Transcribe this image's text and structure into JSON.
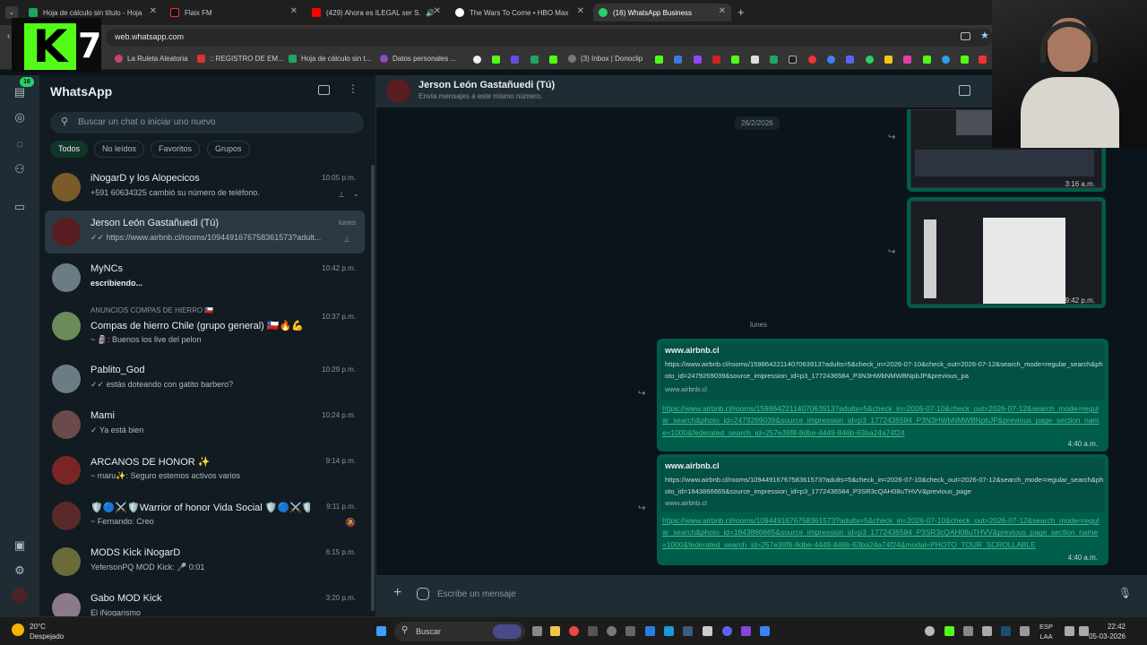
{
  "browser": {
    "tabs": [
      {
        "label": "Hoja de cálculo sin título - Hoja"
      },
      {
        "label": "Flaix FM"
      },
      {
        "label": "(429) Ahora es ILEGAL ser S..."
      },
      {
        "label": "The Wars To Come • HBO Max"
      },
      {
        "label": "(16) WhatsApp Business"
      }
    ],
    "new_tab": "+",
    "url": "web.whatsapp.com",
    "bookmarks": [
      {
        "label": "La Ruleta Aleatoria"
      },
      {
        "label": ":: REGISTRO DE EM..."
      },
      {
        "label": "Hoja de cálculo sin t..."
      },
      {
        "label": "Datos personales ..."
      },
      {
        "label": "(3) Inbox | Donoclip"
      }
    ]
  },
  "overlay": {
    "logo_k": "K",
    "logo_7": "7"
  },
  "rail": {
    "badge": "16"
  },
  "sidebar": {
    "title": "WhatsApp",
    "search_placeholder": "Buscar un chat o iniciar uno nuevo",
    "filters": [
      "Todos",
      "No leídos",
      "Favoritos",
      "Grupos"
    ],
    "chats": [
      {
        "name": "iNogarD y los Alopecicos",
        "sub": "+591 60634325 cambió su número de teléfono.",
        "time": "10:05 p.m.",
        "group": ""
      },
      {
        "name": "Jerson León Gastañuedi (Tú)",
        "sub": "✓✓ https://www.airbnb.cl/rooms/1094491676758361573?adult...",
        "time": "lunes",
        "group": ""
      },
      {
        "name": "MyNCs",
        "sub": "escribiendo...",
        "time": "10:42 p.m.",
        "group": ""
      },
      {
        "name": "Compas de hierro Chile (grupo general) 🇨🇱🔥💪",
        "sub": "~ 🗿: Buenos los live del pelon",
        "time": "10:37 p.m.",
        "group": "ANUNCIOS COMPAS DE HIERRO 🇨🇱"
      },
      {
        "name": "Pablito_God",
        "sub": "✓✓ estás doteando con gatito barbero?",
        "time": "10:29 p.m.",
        "group": ""
      },
      {
        "name": "Mami",
        "sub": "✓ Ya está bien",
        "time": "10:24 p.m.",
        "group": ""
      },
      {
        "name": "ARCANOS DE HONOR ✨",
        "sub": "~ maru✨: Seguro estemos activos varios",
        "time": "9:14 p.m.",
        "group": ""
      },
      {
        "name": "🛡️🔵⚔️🛡️Warrior of honor Vida Social 🛡️🔵⚔️🛡️",
        "sub": "~ Fernando: Creo",
        "time": "9:11 p.m.",
        "group": ""
      },
      {
        "name": "MODS Kick iNogarD",
        "sub": "YefersonPQ MOD Kick: 🎤 0:01",
        "time": "6:15 p.m.",
        "group": ""
      },
      {
        "name": "Gabo MOD Kick",
        "sub": "El iNogarismo",
        "time": "3:20 p.m.",
        "group": ""
      }
    ]
  },
  "chat": {
    "name": "Jerson León Gastañuedi (Tú)",
    "subtitle": "Envía mensajes a este mismo número.",
    "date1": "26/2/2026",
    "date2": "lunes",
    "img_time1": "3:16 a.m.",
    "img_time2": "9:42 p.m.",
    "msg1": {
      "preview_title": "www.airbnb.cl",
      "preview_desc": "https://www.airbnb.cl/rooms/1598642211407063913?adults=5&check_in=2026-07-10&check_out=2026-07-12&search_mode=regular_search&photo_id=2479269039&source_impression_id=p3_1772436584_P3N3HWbNMWBNpbJP&previous_pa",
      "preview_domain": "www.airbnb.cl",
      "link": "https://www.airbnb.cl/rooms/1598642211407063913?adults=5&check_in=2026-07-10&check_out=2026-07-12&search_mode=regular_search&photo_id=2479269039&source_impression_id=p3_1772436584_P3N3HWbNMWBNpbJP&previous_page_section_name=1000&federated_search_id=257e39f8-8dbe-4449-846b-63ba24a74f24",
      "time": "4:40 a.m."
    },
    "msg2": {
      "preview_title": "www.airbnb.cl",
      "preview_desc": "https://www.airbnb.cl/rooms/1094491676758361573?adults=5&check_in=2026-07-10&check_out=2026-07-12&search_mode=regular_search&photo_id=1843866665&source_impression_id=p3_1772436584_P3SR3cQAH08uTHVV&previous_page",
      "preview_domain": "www.airbnb.cl",
      "link": "https://www.airbnb.cl/rooms/1094491676758361573?adults=5&check_in=2026-07-10&check_out=2026-07-12&search_mode=regular_search&photo_id=1843866665&source_impression_id=p3_1772436584_P3SR3cQAH08uTHVV&previous_page_section_name=1000&federated_search_id=257e39f8-8dbe-4449-846b-63ba24a74f24&modal=PHOTO_TOUR_SCROLLABLE",
      "time": "4:40 a.m."
    },
    "composer_placeholder": "Escribe un mensaje"
  },
  "taskbar": {
    "temp": "20°C",
    "weather": "Despejado",
    "search": "Buscar",
    "lang1": "ESP",
    "lang2": "LAA",
    "time": "22:42",
    "date": "05-03-2026"
  },
  "colors": {
    "accent": "#25d366",
    "bubble": "#005c4b",
    "kick": "#53fc18"
  }
}
